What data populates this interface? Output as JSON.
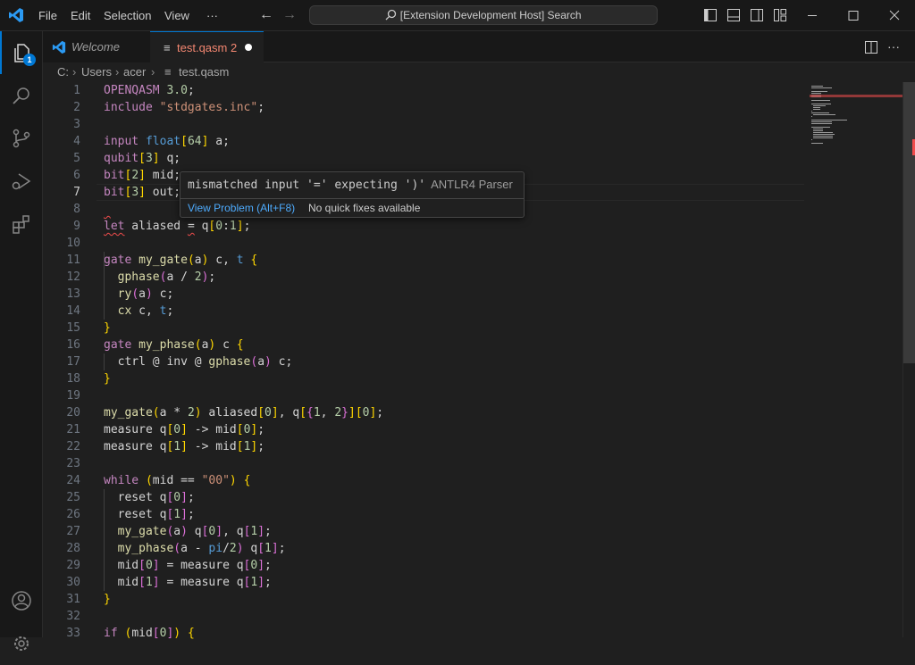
{
  "titlebar": {
    "menu": [
      "File",
      "Edit",
      "Selection",
      "View",
      "···"
    ],
    "search_text": "[Extension Development Host] Search"
  },
  "activity": {
    "explorer_badge": "1"
  },
  "tabs": [
    {
      "label": "Welcome"
    },
    {
      "label": "test.qasm",
      "problems": "2"
    }
  ],
  "breadcrumb": {
    "parts": [
      "C:",
      "Users",
      "acer",
      "test.qasm"
    ]
  },
  "editor": {
    "current_line": 7,
    "lines": [
      [
        [
          "kw",
          "OPENQASM"
        ],
        [
          "pl",
          " "
        ],
        [
          "num",
          "3.0"
        ],
        [
          "pl",
          ";"
        ]
      ],
      [
        [
          "kw",
          "include"
        ],
        [
          "pl",
          " "
        ],
        [
          "str",
          "\"stdgates.inc\""
        ],
        [
          "pl",
          ";"
        ]
      ],
      [],
      [
        [
          "kw",
          "input"
        ],
        [
          "pl",
          " "
        ],
        [
          "ty",
          "float"
        ],
        [
          "br0",
          "["
        ],
        [
          "num",
          "64"
        ],
        [
          "br0",
          "]"
        ],
        [
          "pl",
          " a;"
        ]
      ],
      [
        [
          "kw",
          "qubit"
        ],
        [
          "br0",
          "["
        ],
        [
          "num",
          "3"
        ],
        [
          "br0",
          "]"
        ],
        [
          "pl",
          " q;"
        ]
      ],
      [
        [
          "kw",
          "bit"
        ],
        [
          "br0",
          "["
        ],
        [
          "num",
          "2"
        ],
        [
          "br0",
          "]"
        ],
        [
          "pl",
          " mid;"
        ]
      ],
      [
        [
          "kw",
          "bit"
        ],
        [
          "br0",
          "["
        ],
        [
          "num",
          "3"
        ],
        [
          "br0",
          "]"
        ],
        [
          "pl",
          " out;"
        ]
      ],
      [],
      [
        [
          "kw",
          "let"
        ],
        [
          "pl",
          " aliased = q"
        ],
        [
          "br0",
          "["
        ],
        [
          "num",
          "0"
        ],
        [
          "pl",
          ":"
        ],
        [
          "num",
          "1"
        ],
        [
          "br0",
          "]"
        ],
        [
          "pl",
          ";"
        ]
      ],
      [],
      [
        [
          "kw",
          "gate"
        ],
        [
          "pl",
          " "
        ],
        [
          "fn",
          "my_gate"
        ],
        [
          "br0",
          "("
        ],
        [
          "pl",
          "a"
        ],
        [
          "br0",
          ")"
        ],
        [
          "pl",
          " c, "
        ],
        [
          "ty",
          "t"
        ],
        [
          "pl",
          " "
        ],
        [
          "br0",
          "{"
        ]
      ],
      [
        [
          "pl",
          "  "
        ],
        [
          "fn",
          "gphase"
        ],
        [
          "br1",
          "("
        ],
        [
          "pl",
          "a / "
        ],
        [
          "num",
          "2"
        ],
        [
          "br1",
          ")"
        ],
        [
          "pl",
          ";"
        ]
      ],
      [
        [
          "pl",
          "  "
        ],
        [
          "fn",
          "ry"
        ],
        [
          "br1",
          "("
        ],
        [
          "pl",
          "a"
        ],
        [
          "br1",
          ")"
        ],
        [
          "pl",
          " c;"
        ]
      ],
      [
        [
          "pl",
          "  "
        ],
        [
          "fn",
          "cx"
        ],
        [
          "pl",
          " c, "
        ],
        [
          "ty",
          "t"
        ],
        [
          "pl",
          ";"
        ]
      ],
      [
        [
          "br0",
          "}"
        ]
      ],
      [
        [
          "kw",
          "gate"
        ],
        [
          "pl",
          " "
        ],
        [
          "fn",
          "my_phase"
        ],
        [
          "br0",
          "("
        ],
        [
          "pl",
          "a"
        ],
        [
          "br0",
          ")"
        ],
        [
          "pl",
          " c "
        ],
        [
          "br0",
          "{"
        ]
      ],
      [
        [
          "pl",
          "  ctrl @ inv @ "
        ],
        [
          "fn",
          "gphase"
        ],
        [
          "br1",
          "("
        ],
        [
          "pl",
          "a"
        ],
        [
          "br1",
          ")"
        ],
        [
          "pl",
          " c;"
        ]
      ],
      [
        [
          "br0",
          "}"
        ]
      ],
      [],
      [
        [
          "fn",
          "my_gate"
        ],
        [
          "br0",
          "("
        ],
        [
          "pl",
          "a * "
        ],
        [
          "num",
          "2"
        ],
        [
          "br0",
          ")"
        ],
        [
          "pl",
          " aliased"
        ],
        [
          "br0",
          "["
        ],
        [
          "num",
          "0"
        ],
        [
          "br0",
          "]"
        ],
        [
          "pl",
          ", q"
        ],
        [
          "br0",
          "["
        ],
        [
          "br1",
          "{"
        ],
        [
          "num",
          "1"
        ],
        [
          "pl",
          ", "
        ],
        [
          "num",
          "2"
        ],
        [
          "br1",
          "}"
        ],
        [
          "br0",
          "]"
        ],
        [
          "br0",
          "["
        ],
        [
          "num",
          "0"
        ],
        [
          "br0",
          "]"
        ],
        [
          "pl",
          ";"
        ]
      ],
      [
        [
          "pl",
          "measure q"
        ],
        [
          "br0",
          "["
        ],
        [
          "num",
          "0"
        ],
        [
          "br0",
          "]"
        ],
        [
          "pl",
          " -> mid"
        ],
        [
          "br0",
          "["
        ],
        [
          "num",
          "0"
        ],
        [
          "br0",
          "]"
        ],
        [
          "pl",
          ";"
        ]
      ],
      [
        [
          "pl",
          "measure q"
        ],
        [
          "br0",
          "["
        ],
        [
          "num",
          "1"
        ],
        [
          "br0",
          "]"
        ],
        [
          "pl",
          " -> mid"
        ],
        [
          "br0",
          "["
        ],
        [
          "num",
          "1"
        ],
        [
          "br0",
          "]"
        ],
        [
          "pl",
          ";"
        ]
      ],
      [],
      [
        [
          "kw",
          "while"
        ],
        [
          "pl",
          " "
        ],
        [
          "br0",
          "("
        ],
        [
          "pl",
          "mid == "
        ],
        [
          "str",
          "\"00\""
        ],
        [
          "br0",
          ")"
        ],
        [
          "pl",
          " "
        ],
        [
          "br0",
          "{"
        ]
      ],
      [
        [
          "pl",
          "  reset q"
        ],
        [
          "br1",
          "["
        ],
        [
          "num",
          "0"
        ],
        [
          "br1",
          "]"
        ],
        [
          "pl",
          ";"
        ]
      ],
      [
        [
          "pl",
          "  reset q"
        ],
        [
          "br1",
          "["
        ],
        [
          "num",
          "1"
        ],
        [
          "br1",
          "]"
        ],
        [
          "pl",
          ";"
        ]
      ],
      [
        [
          "pl",
          "  "
        ],
        [
          "fn",
          "my_gate"
        ],
        [
          "br1",
          "("
        ],
        [
          "pl",
          "a"
        ],
        [
          "br1",
          ")"
        ],
        [
          "pl",
          " q"
        ],
        [
          "br1",
          "["
        ],
        [
          "num",
          "0"
        ],
        [
          "br1",
          "]"
        ],
        [
          "pl",
          ", q"
        ],
        [
          "br1",
          "["
        ],
        [
          "num",
          "1"
        ],
        [
          "br1",
          "]"
        ],
        [
          "pl",
          ";"
        ]
      ],
      [
        [
          "pl",
          "  "
        ],
        [
          "fn",
          "my_phase"
        ],
        [
          "br1",
          "("
        ],
        [
          "pl",
          "a - "
        ],
        [
          "ty",
          "pi"
        ],
        [
          "pl",
          "/"
        ],
        [
          "num",
          "2"
        ],
        [
          "br1",
          ")"
        ],
        [
          "pl",
          " q"
        ],
        [
          "br1",
          "["
        ],
        [
          "num",
          "1"
        ],
        [
          "br1",
          "]"
        ],
        [
          "pl",
          ";"
        ]
      ],
      [
        [
          "pl",
          "  mid"
        ],
        [
          "br1",
          "["
        ],
        [
          "num",
          "0"
        ],
        [
          "br1",
          "]"
        ],
        [
          "pl",
          " = measure q"
        ],
        [
          "br1",
          "["
        ],
        [
          "num",
          "0"
        ],
        [
          "br1",
          "]"
        ],
        [
          "pl",
          ";"
        ]
      ],
      [
        [
          "pl",
          "  mid"
        ],
        [
          "br1",
          "["
        ],
        [
          "num",
          "1"
        ],
        [
          "br1",
          "]"
        ],
        [
          "pl",
          " = measure q"
        ],
        [
          "br1",
          "["
        ],
        [
          "num",
          "1"
        ],
        [
          "br1",
          "]"
        ],
        [
          "pl",
          ";"
        ]
      ],
      [
        [
          "br0",
          "}"
        ]
      ],
      [],
      [
        [
          "kw",
          "if"
        ],
        [
          "pl",
          " "
        ],
        [
          "br0",
          "("
        ],
        [
          "pl",
          "mid"
        ],
        [
          "br1",
          "["
        ],
        [
          "num",
          "0"
        ],
        [
          "br1",
          "]"
        ],
        [
          "br0",
          ")"
        ],
        [
          "pl",
          " "
        ],
        [
          "br0",
          "{"
        ]
      ]
    ]
  },
  "hover": {
    "message": "mismatched input '=' expecting ')'",
    "source": "ANTLR4 Parser",
    "view_problem": "View Problem (Alt+F8)",
    "no_fixes": "No quick fixes available"
  },
  "colors": {
    "accent": "#0078d4",
    "error": "#f14c4c",
    "tab_error": "#f48771"
  }
}
